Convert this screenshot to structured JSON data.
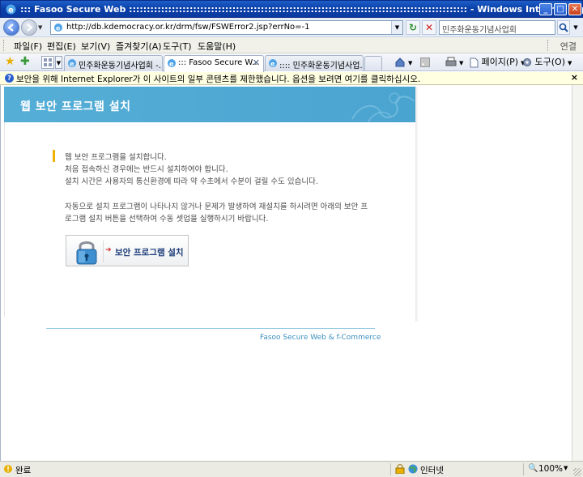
{
  "window": {
    "title": "::: Fasoo Secure Web ::::::::::::::::::::::::::::::::::::::::::::::::::::::::::::::::::::::::::::::::::::::::::::::: - Windows Internet Explorer"
  },
  "address": {
    "url": "http://db.kdemocracy.or.kr/drm/fsw/FSWError2.jsp?errNo=-1"
  },
  "search": {
    "value": "민주화운동기념사업회"
  },
  "menu": {
    "items": [
      "파일(F)",
      "편집(E)",
      "보기(V)",
      "즐겨찾기(A)",
      "도구(T)",
      "도움말(H)"
    ],
    "links_label": "연결"
  },
  "tabs": [
    {
      "label": "민주화운동기념사업회 -...",
      "active": false
    },
    {
      "label": "::: Fasoo Secure W...",
      "active": true
    },
    {
      "label": ":::: 민주화운동기념사업...",
      "active": false
    }
  ],
  "toolbar": {
    "page_label": "페이지(P)",
    "tools_label": "도구(O)"
  },
  "infobar": {
    "message": "보안을 위해 Internet Explorer가 이 사이트의 일부 콘텐츠를 제한했습니다. 옵션을 보려면 여기를 클릭하십시오."
  },
  "page": {
    "banner_title": "웹 보안 프로그램 설치",
    "lines": [
      "웹 보안 프로그램을 설치합니다.",
      "처음 접속하신 경우에는 반드시 설치하여야 합니다.",
      "설치 시간은 사용자의 통신환경에 따라 약 수초에서 수분이 걸릴 수도 있습니다.",
      "자동으로 설치 프로그램이 나타나지 않거나 문제가 발생하여 재설치를 하시려면 아래의 보안 프",
      "로그램 설치 버튼을 선택하여 수동 셋업을 실행하시기 바랍니다."
    ],
    "install_button_label": "보안 프로그램 설치",
    "footer": "Fasoo Secure Web & f-Commerce"
  },
  "status": {
    "text": "완료",
    "zone": "인터넷",
    "zoom": "100%"
  }
}
